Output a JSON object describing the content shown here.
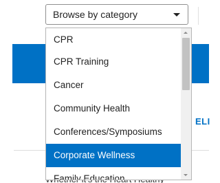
{
  "select": {
    "value": "Browse by category",
    "icon": "chevron-down-icon"
  },
  "dropdown": {
    "options": [
      {
        "label": "CPR",
        "selected": false
      },
      {
        "label": "CPR Training",
        "selected": false
      },
      {
        "label": "Cancer",
        "selected": false
      },
      {
        "label": "Community Health",
        "selected": false
      },
      {
        "label": "Conferences/Symposiums",
        "selected": false
      },
      {
        "label": "Corporate Wellness",
        "selected": true
      },
      {
        "label": "Family Education",
        "selected": false
      }
    ]
  },
  "background": {
    "link_fragment": "ELI",
    "bottom_text_fragment": "Whether it's the Heart Healthy"
  },
  "colors": {
    "accent": "#0071c5",
    "selected_text": "#ffffff"
  }
}
